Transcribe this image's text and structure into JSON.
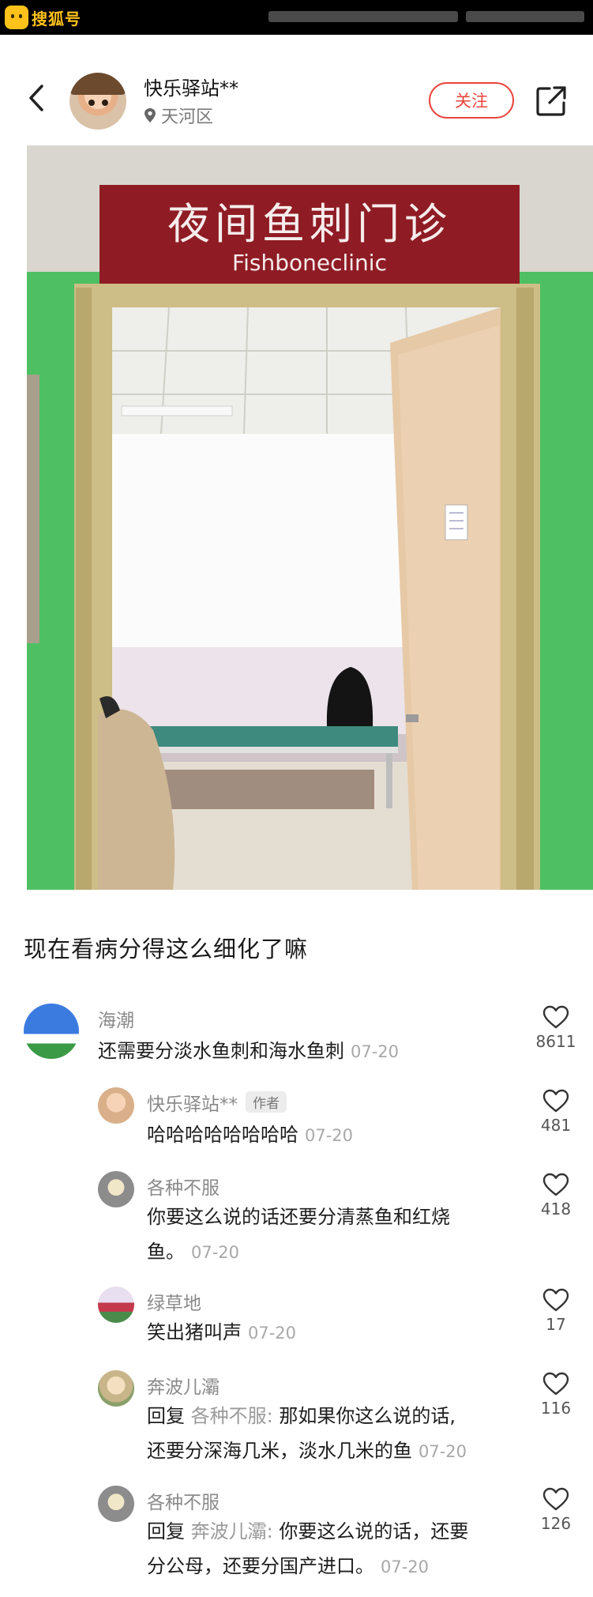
{
  "watermark": {
    "text": "搜狐号"
  },
  "header": {
    "username": "快乐驿站**",
    "location": "天河区",
    "follow_label": "关注"
  },
  "photo": {
    "sign_cn": "夜间鱼刺门诊",
    "sign_en": "Fishboneclinic"
  },
  "post": {
    "caption": "现在看病分得这么细化了嘛"
  },
  "comments": [
    {
      "name": "海潮",
      "text": "还需要分淡水鱼刺和海水鱼刺",
      "date": "07-20",
      "likes": "8611"
    },
    {
      "name": "快乐驿站**",
      "author_tag": "作者",
      "text": "哈哈哈哈哈哈哈哈",
      "date": "07-20",
      "likes": "481"
    },
    {
      "name": "各种不服",
      "text_line1": "你要这么说的话还要分清蒸鱼和红烧",
      "text_line2": "鱼。",
      "date": "07-20",
      "likes": "418"
    },
    {
      "name": "绿草地",
      "text": "笑出猪叫声",
      "date": "07-20",
      "likes": "17"
    },
    {
      "name": "奔波儿灞",
      "reply_label": "回复",
      "reply_to": "各种不服:",
      "text_line1": " 那如果你这么说的话,",
      "text_line2": "还要分深海几米，淡水几米的鱼",
      "date": "07-20",
      "likes": "116"
    },
    {
      "name": "各种不服",
      "reply_label": "回复",
      "reply_to": "奔波儿灞:",
      "text_line1": " 你要这么说的话，还要",
      "text_line2": "分公母，还要分国产进口。",
      "date": "07-20",
      "likes": "126"
    }
  ],
  "colors": {
    "accent": "#e8453c",
    "wall_green": "#4fbf63",
    "sign_red": "#8f1c24"
  }
}
